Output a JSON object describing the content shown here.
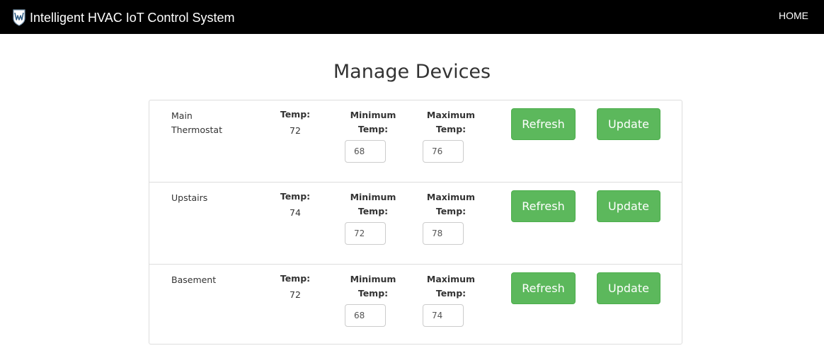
{
  "navbar": {
    "title": "Intelligent HVAC IoT Control System",
    "home_label": "HOME",
    "logo_icon": "shield-logo-icon"
  },
  "page": {
    "title": "Manage Devices"
  },
  "labels": {
    "temp": "Temp:",
    "min_line1": "Minimum",
    "min_line2": "Temp:",
    "max_line1": "Maximum",
    "max_line2": "Temp:",
    "refresh": "Refresh",
    "update": "Update"
  },
  "devices": [
    {
      "name": "Main Thermostat",
      "temp": "72",
      "min_temp": "68",
      "max_temp": "76"
    },
    {
      "name": "Upstairs",
      "temp": "74",
      "min_temp": "72",
      "max_temp": "78"
    },
    {
      "name": "Basement",
      "temp": "72",
      "min_temp": "68",
      "max_temp": "74"
    }
  ],
  "colors": {
    "navbar_bg": "#000000",
    "button_green": "#5cb85c",
    "border": "#dddddd"
  }
}
